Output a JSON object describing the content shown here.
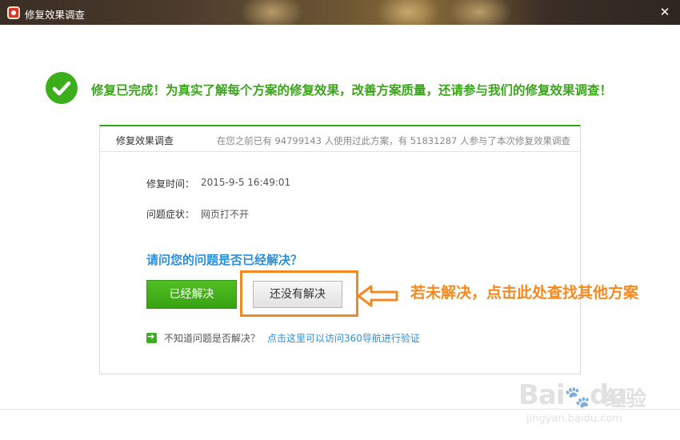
{
  "window": {
    "title": "修复效果调查",
    "close_symbol": "✕"
  },
  "banner": {
    "message": "修复已完成！为真实了解每个方案的修复效果，改善方案质量，还请参与我们的修复效果调查！"
  },
  "card": {
    "title": "修复效果调查",
    "stats": "在您之前已有 94799143 人使用过此方案，有 51831287 人参与了本次修复效果调查",
    "repair_time_label": "修复时间：",
    "repair_time_value": "2015-9-5 16:49:01",
    "symptom_label": "问题症状：",
    "symptom_value": "网页打不开",
    "question": "请问您的问题是否已经解决？",
    "solved_button": "已经解决",
    "unsolved_button": "还没有解决",
    "unknown_text": "不知道问题是否解决？",
    "verify_link": "点击这里可以访问360导航进行验证"
  },
  "annotation": {
    "text": "若未解决，点击此处查找其他方案"
  },
  "watermark": {
    "brand": "Bai",
    "brand2": "du",
    "label": "经验",
    "url": "jingyan.baidu.com"
  },
  "colors": {
    "accent_green": "#3cae1c",
    "link_blue": "#2d8ed8",
    "annotation_orange": "#f48a1f"
  }
}
